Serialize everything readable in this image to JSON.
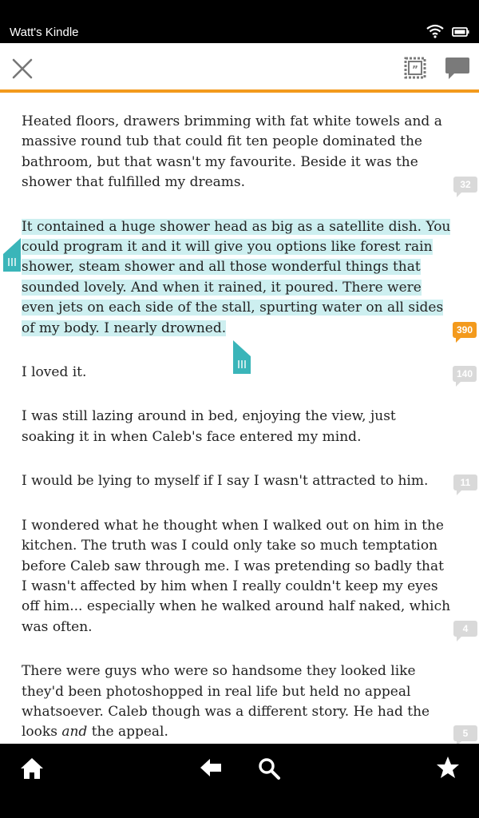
{
  "status": {
    "device_name": "Watt's Kindle"
  },
  "toolbar": {
    "close_icon": "close-icon",
    "quote_icon": "quote-frame-icon",
    "comment_icon": "comment-icon"
  },
  "paragraphs": [
    {
      "text": "Heated floors, drawers brimming with fat white towels and a massive round tub that could fit ten people dominated the bathroom, but that wasn't my favourite. Beside it was the shower that fulfilled my dreams.",
      "badge": "32"
    },
    {
      "text": "It contained a huge shower head as big as a satellite dish. You could program it and it will give you options like forest rain shower, steam shower and all those wonderful things that sounded lovely. And when it rained, it poured. There were even jets on each side of the stall, spurting water on all sides of my body. I nearly drowned.",
      "badge": "390"
    },
    {
      "text": "I loved it.",
      "badge": "140"
    },
    {
      "text": "I was still lazing around in bed, enjoying the view, just soaking it in when Caleb's face entered my mind."
    },
    {
      "text": "I would be lying to myself if I say I wasn't attracted to him.",
      "badge": "11"
    },
    {
      "text": "I wondered what he thought when I walked out on him in the kitchen. The truth was I could only take so much temptation before Caleb saw through me. I was pretending so badly that I wasn't affected by him when I really couldn't keep my eyes off him... especially when he walked around half naked, which was often.",
      "badge": "4"
    },
    {
      "text_before": "There were guys who were so handsome they looked like they'd been photoshopped in real life but held no appeal whatsoever. Caleb though was a different story. He had the looks ",
      "text_em": "and",
      "text_after": " the appeal.",
      "badge": "5"
    }
  ],
  "bottom_nav": [
    "home-icon",
    "back-arrow-icon",
    "search-icon",
    "star-icon"
  ],
  "colors": {
    "accent": "#f39a1d",
    "highlight": "#cdeff0",
    "handle": "#3ab5b9",
    "badge": "#d9d9d9"
  }
}
